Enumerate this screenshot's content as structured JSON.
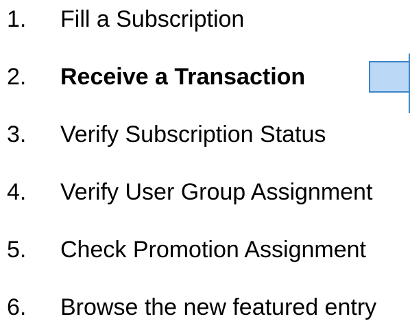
{
  "steps": [
    {
      "number": "1.",
      "label": "Fill a Subscription"
    },
    {
      "number": "2.",
      "label": "Receive a Transaction"
    },
    {
      "number": "3.",
      "label": "Verify Subscription Status"
    },
    {
      "number": "4.",
      "label": "Verify User Group Assignment"
    },
    {
      "number": "5.",
      "label": "Check Promotion Assignment"
    },
    {
      "number": "6.",
      "label": "Browse the new featured entry"
    }
  ],
  "active_step": 2,
  "colors": {
    "callout_fill": "#bcd8f7",
    "callout_border": "#3b83c6",
    "text": "#000000"
  }
}
